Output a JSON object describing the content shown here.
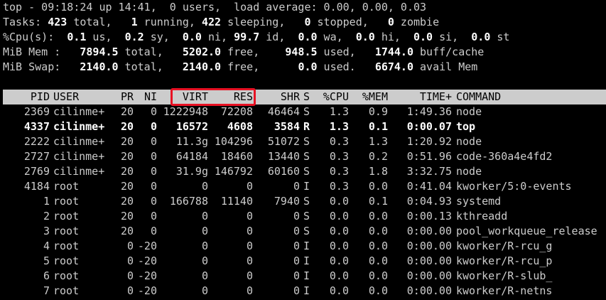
{
  "summary": {
    "line1": "top - 09:18:24 up 14:41,  0 users,  load average: 0.00, 0.00, 0.03",
    "tasks": {
      "label": "Tasks: ",
      "total": "423",
      "total_l": " total,   ",
      "running": "1",
      "running_l": " running, ",
      "sleeping": "422",
      "sleeping_l": " sleeping,   ",
      "stopped": "0",
      "stopped_l": " stopped,   ",
      "zombie": "0",
      "zombie_l": " zombie"
    },
    "cpu": {
      "label": "%Cpu(s):  ",
      "us": "0.1",
      "us_l": " us,  ",
      "sy": "0.2",
      "sy_l": " sy,  ",
      "ni": "0.0",
      "ni_l": " ni, ",
      "id": "99.7",
      "id_l": " id,  ",
      "wa": "0.0",
      "wa_l": " wa,  ",
      "hi": "0.0",
      "hi_l": " hi,  ",
      "si": "0.0",
      "si_l": " si,  ",
      "st": "0.0",
      "st_l": " st"
    },
    "mem": {
      "label": "MiB Mem :   ",
      "total": "7894.5",
      "total_l": " total,   ",
      "free": "5202.0",
      "free_l": " free,    ",
      "used": "948.5",
      "used_l": " used,   ",
      "buff": "1744.0",
      "buff_l": " buff/cache"
    },
    "swap": {
      "label": "MiB Swap:   ",
      "total": "2140.0",
      "total_l": " total,   ",
      "free": "2140.0",
      "free_l": " free,      ",
      "used": "0.0",
      "used_l": " used.   ",
      "avail": "6674.0",
      "avail_l": " avail Mem"
    }
  },
  "table": {
    "headers": {
      "pid": "PID",
      "user": "USER",
      "pr": "PR",
      "ni": "NI",
      "virt": "VIRT",
      "res": "RES",
      "shr": "SHR",
      "s": "S",
      "cpu": "%CPU",
      "mem": "%MEM",
      "time": "TIME+",
      "command": "COMMAND"
    },
    "rows": [
      {
        "pid": "2369",
        "user": "cilinme+",
        "pr": "20",
        "ni": "0",
        "virt": "1222948",
        "res": "72208",
        "shr": "46464",
        "s": "S",
        "cpu": "1.3",
        "mem": "0.9",
        "time": "1:49.36",
        "command": "node"
      },
      {
        "pid": "4337",
        "user": "cilinme+",
        "pr": "20",
        "ni": "0",
        "virt": "16572",
        "res": "4608",
        "shr": "3584",
        "s": "R",
        "cpu": "1.3",
        "mem": "0.1",
        "time": "0:00.07",
        "command": "top"
      },
      {
        "pid": "2222",
        "user": "cilinme+",
        "pr": "20",
        "ni": "0",
        "virt": "11.3g",
        "res": "104296",
        "shr": "51072",
        "s": "S",
        "cpu": "0.3",
        "mem": "1.3",
        "time": "1:20.92",
        "command": "node"
      },
      {
        "pid": "2727",
        "user": "cilinme+",
        "pr": "20",
        "ni": "0",
        "virt": "64184",
        "res": "18460",
        "shr": "13440",
        "s": "S",
        "cpu": "0.3",
        "mem": "0.2",
        "time": "0:51.96",
        "command": "code-360a4e4fd2"
      },
      {
        "pid": "2769",
        "user": "cilinme+",
        "pr": "20",
        "ni": "0",
        "virt": "31.9g",
        "res": "146792",
        "shr": "60160",
        "s": "S",
        "cpu": "0.3",
        "mem": "1.8",
        "time": "3:32.75",
        "command": "node"
      },
      {
        "pid": "4184",
        "user": "root",
        "pr": "20",
        "ni": "0",
        "virt": "0",
        "res": "0",
        "shr": "0",
        "s": "I",
        "cpu": "0.3",
        "mem": "0.0",
        "time": "0:41.04",
        "command": "kworker/5:0-events"
      },
      {
        "pid": "1",
        "user": "root",
        "pr": "20",
        "ni": "0",
        "virt": "166788",
        "res": "11140",
        "shr": "7940",
        "s": "S",
        "cpu": "0.0",
        "mem": "0.1",
        "time": "0:04.93",
        "command": "systemd"
      },
      {
        "pid": "2",
        "user": "root",
        "pr": "20",
        "ni": "0",
        "virt": "0",
        "res": "0",
        "shr": "0",
        "s": "S",
        "cpu": "0.0",
        "mem": "0.0",
        "time": "0:00.13",
        "command": "kthreadd"
      },
      {
        "pid": "3",
        "user": "root",
        "pr": "20",
        "ni": "0",
        "virt": "0",
        "res": "0",
        "shr": "0",
        "s": "S",
        "cpu": "0.0",
        "mem": "0.0",
        "time": "0:00.00",
        "command": "pool_workqueue_release"
      },
      {
        "pid": "4",
        "user": "root",
        "pr": "0",
        "ni": "-20",
        "virt": "0",
        "res": "0",
        "shr": "0",
        "s": "I",
        "cpu": "0.0",
        "mem": "0.0",
        "time": "0:00.00",
        "command": "kworker/R-rcu_g"
      },
      {
        "pid": "5",
        "user": "root",
        "pr": "0",
        "ni": "-20",
        "virt": "0",
        "res": "0",
        "shr": "0",
        "s": "I",
        "cpu": "0.0",
        "mem": "0.0",
        "time": "0:00.00",
        "command": "kworker/R-rcu_p"
      },
      {
        "pid": "6",
        "user": "root",
        "pr": "0",
        "ni": "-20",
        "virt": "0",
        "res": "0",
        "shr": "0",
        "s": "I",
        "cpu": "0.0",
        "mem": "0.0",
        "time": "0:00.00",
        "command": "kworker/R-slub_"
      },
      {
        "pid": "7",
        "user": "root",
        "pr": "0",
        "ni": "-20",
        "virt": "0",
        "res": "0",
        "shr": "0",
        "s": "I",
        "cpu": "0.0",
        "mem": "0.0",
        "time": "0:00.00",
        "command": "kworker/R-netns"
      }
    ],
    "bold_row": 1
  },
  "colors": {
    "background": "#000000",
    "text": "#cccccc",
    "header_bg": "#cccccc",
    "highlight_border": "#e81123"
  }
}
